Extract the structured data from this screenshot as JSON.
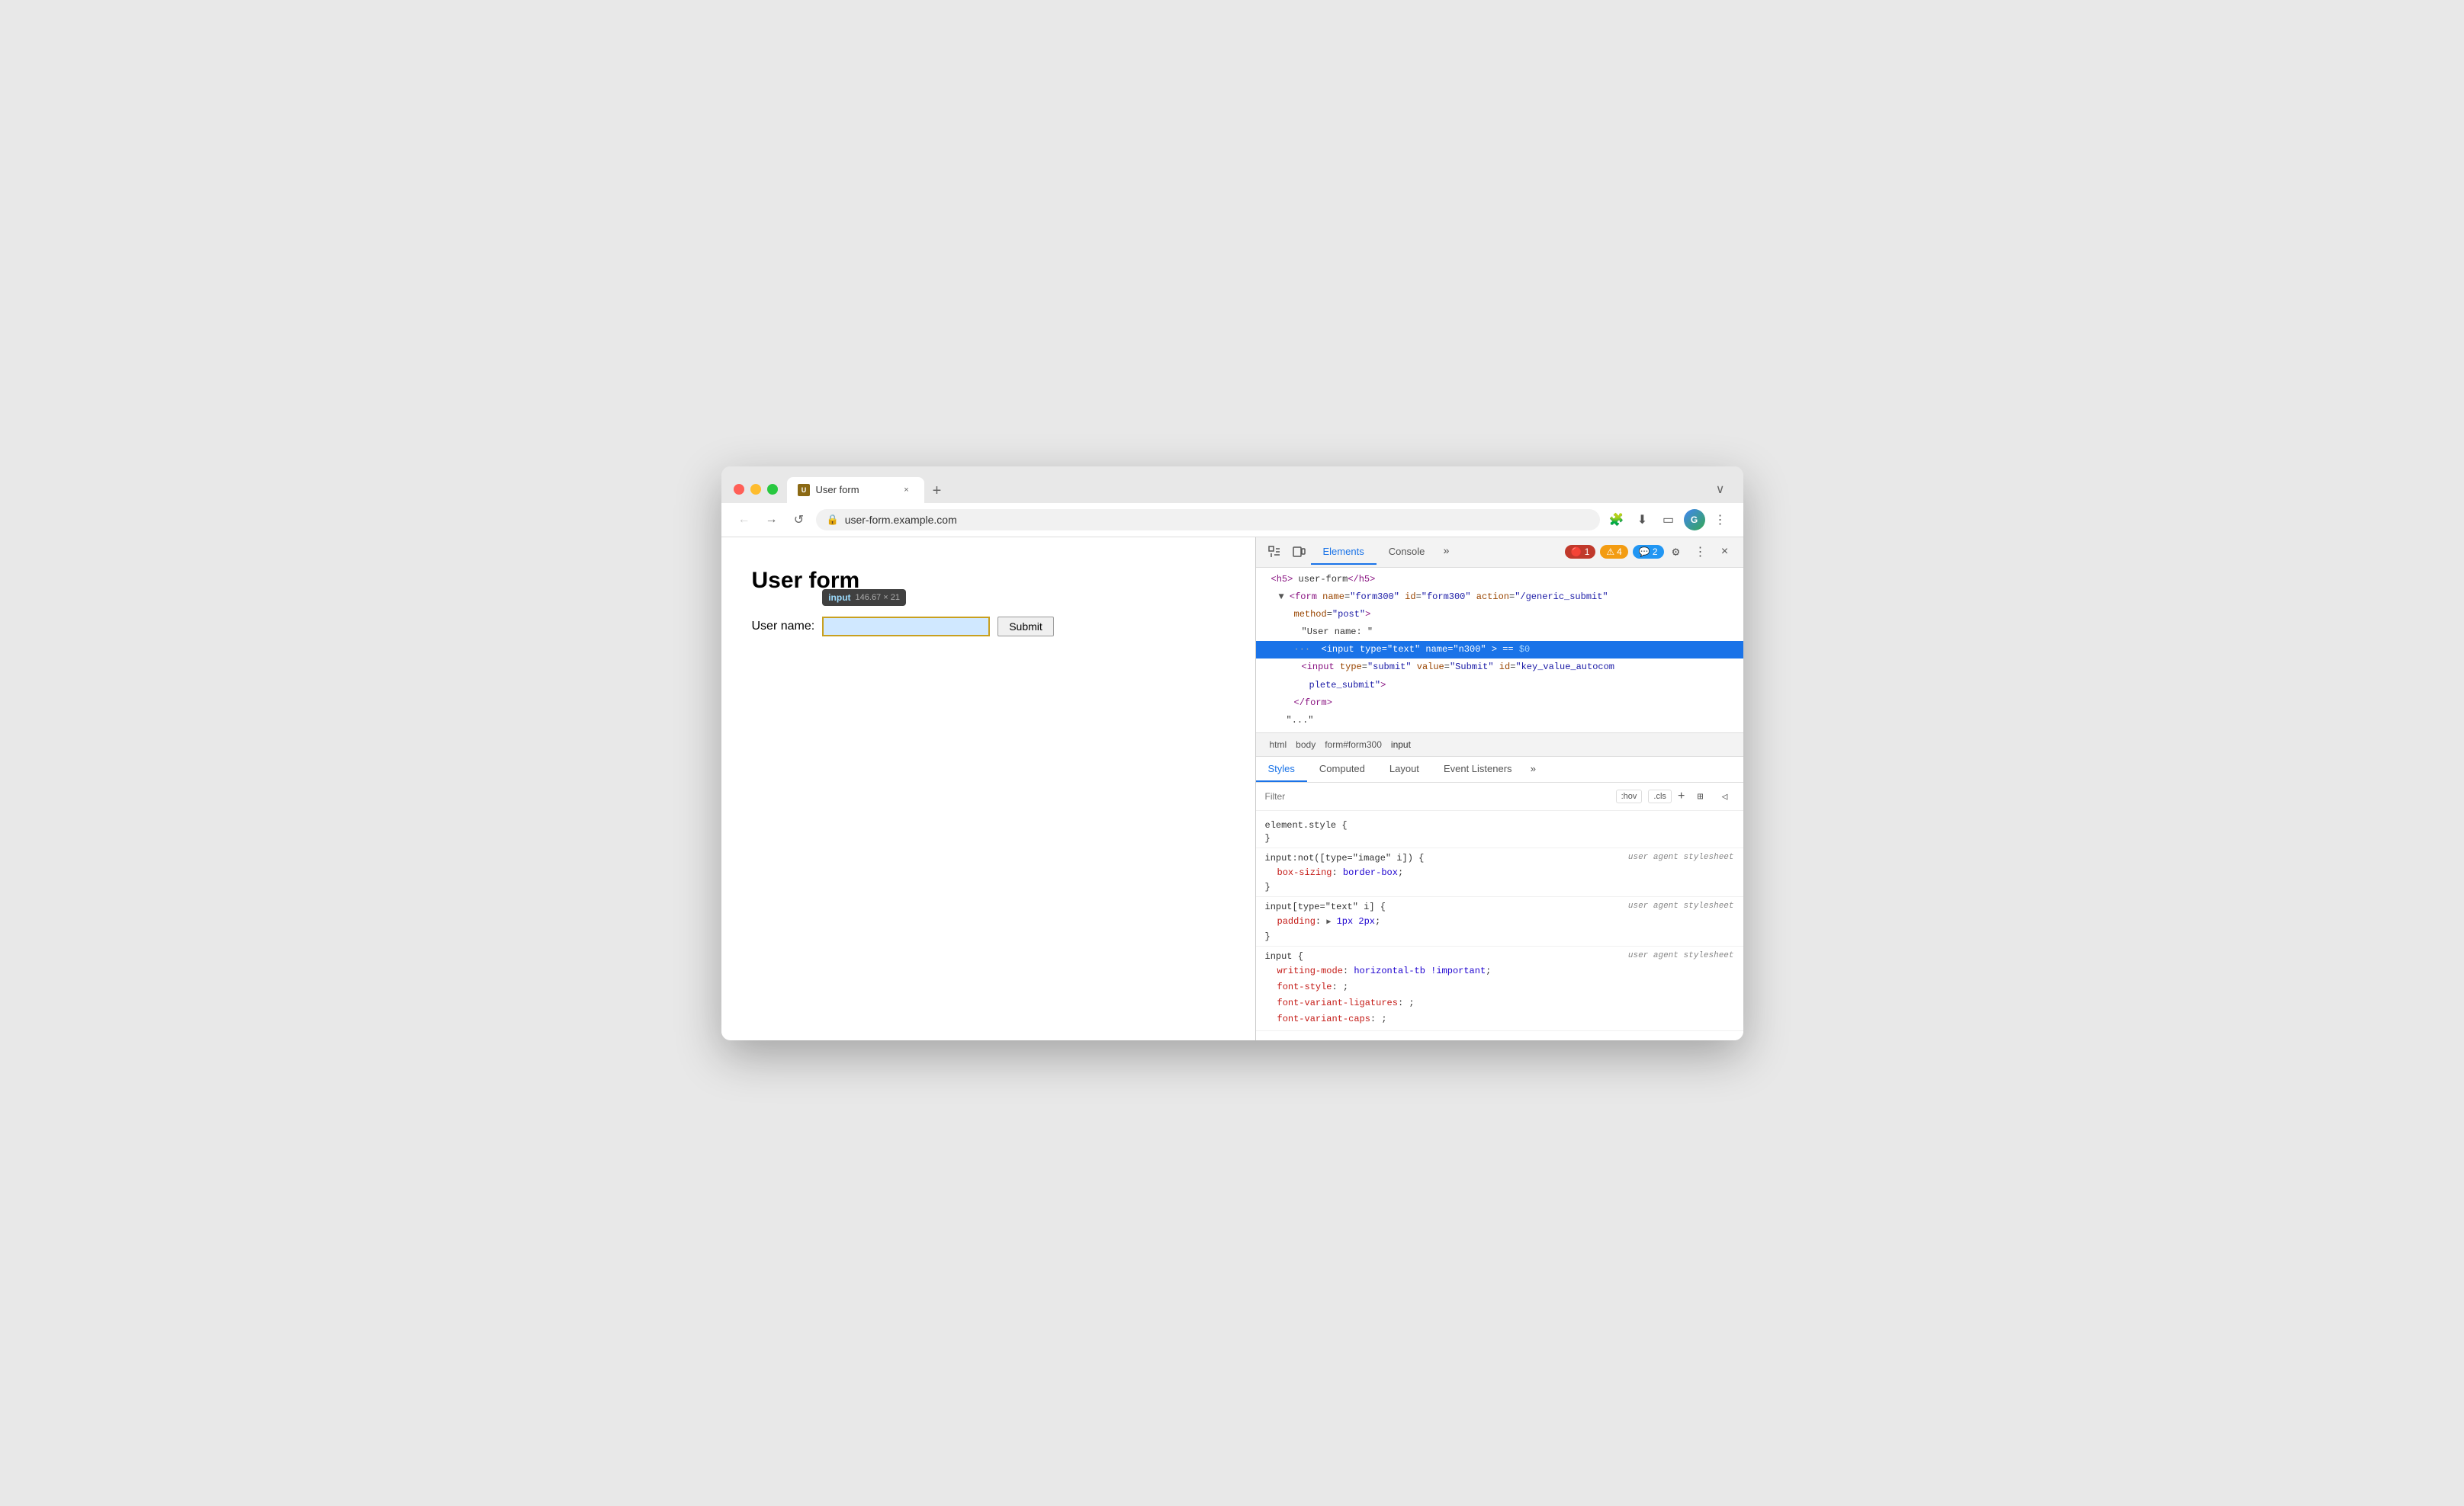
{
  "browser": {
    "traffic_lights": [
      "close",
      "minimize",
      "maximize"
    ],
    "tab": {
      "favicon_text": "U",
      "title": "User form",
      "close_label": "×"
    },
    "new_tab_label": "+",
    "tab_overflow_label": "∨",
    "address": "user-form.example.com",
    "nav": {
      "back": "←",
      "forward": "→",
      "refresh": "↺"
    },
    "toolbar_icons": [
      "extensions",
      "download",
      "cast",
      "profile",
      "menu"
    ],
    "profile_initial": "G"
  },
  "page": {
    "title": "User form",
    "form": {
      "label": "User name:",
      "input_tooltip_tag": "input",
      "input_tooltip_size": "146.67 × 21",
      "submit_label": "Submit"
    }
  },
  "devtools": {
    "panel_icon1": "⬚",
    "panel_icon2": "⬛",
    "tabs": [
      {
        "label": "Elements",
        "active": true
      },
      {
        "label": "Console",
        "active": false
      }
    ],
    "more_tabs_label": "»",
    "badges": {
      "error": {
        "icon": "🔴",
        "count": "1"
      },
      "warning": {
        "icon": "⚠",
        "count": "4"
      },
      "info": {
        "icon": "💬",
        "count": "2"
      }
    },
    "settings_icon": "⚙",
    "menu_icon": "⋮",
    "close_icon": "×",
    "dom": {
      "lines": [
        {
          "indent": 0,
          "html": "<h5> user-form</h5>",
          "raw": "&lt;h5&gt; user-form&lt;/h5&gt;"
        },
        {
          "indent": 1,
          "type": "form",
          "content": "▼<form name=\"form300\" id=\"form300\" action=\"/generic_submit\""
        },
        {
          "indent": 2,
          "content": "method=\"post\">"
        },
        {
          "indent": 3,
          "content": "\"User name: \""
        },
        {
          "indent": 3,
          "selected": true,
          "content": "<input type=\"text\" name=\"n300\"> == $0"
        },
        {
          "indent": 3,
          "content": "<input type=\"submit\" value=\"Submit\" id=\"key_value_autocom"
        },
        {
          "indent": 3,
          "content": "plete_submit\">"
        },
        {
          "indent": 2,
          "content": "</form>"
        },
        {
          "indent": 1,
          "content": "\"...\""
        }
      ]
    },
    "breadcrumb": [
      {
        "label": "html"
      },
      {
        "label": "body"
      },
      {
        "label": "form#form300"
      },
      {
        "label": "input"
      }
    ],
    "style_tabs": [
      {
        "label": "Styles",
        "active": true
      },
      {
        "label": "Computed",
        "active": false
      },
      {
        "label": "Layout",
        "active": false
      },
      {
        "label": "Event Listeners",
        "active": false
      }
    ],
    "style_tabs_more": "»",
    "filter": {
      "placeholder": "Filter",
      "pseudo_label": ":hov",
      "cls_label": ".cls",
      "plus_label": "+",
      "icons": [
        "⊞",
        "◁"
      ]
    },
    "styles": [
      {
        "selector": "element.style {",
        "source": "",
        "props": [],
        "close": "}"
      },
      {
        "selector": "input:not([type=\"image\" i]) {",
        "source": "user agent stylesheet",
        "props": [
          {
            "name": "box-sizing",
            "value": "border-box"
          }
        ],
        "close": "}"
      },
      {
        "selector": "input[type=\"text\" i] {",
        "source": "user agent stylesheet",
        "props": [
          {
            "name": "padding",
            "value": "▶ 1px 2px",
            "has_triangle": true
          }
        ],
        "close": "}"
      },
      {
        "selector": "input {",
        "source": "user agent stylesheet",
        "props": [
          {
            "name": "writing-mode",
            "value": "horizontal-tb !important"
          },
          {
            "name": "font-style",
            "value": ";"
          },
          {
            "name": "font-variant-ligatures",
            "value": ";"
          },
          {
            "name": "font-variant-caps",
            "value": ";"
          }
        ],
        "close": ""
      }
    ]
  }
}
